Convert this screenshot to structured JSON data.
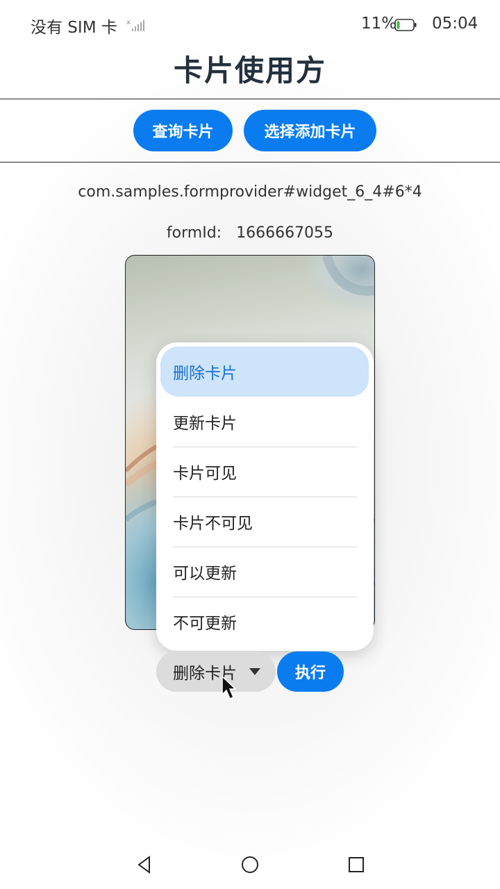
{
  "status_bar": {
    "sim_text": "没有 SIM 卡",
    "battery_text": "11%",
    "time": "05:04"
  },
  "header": {
    "title": "卡片使用方"
  },
  "actions": {
    "query_label": "查询卡片",
    "select_add_label": "选择添加卡片"
  },
  "info": {
    "form_name": "com.samples.formprovider#widget_6_4#6*4",
    "form_id_label": "formId:",
    "form_id_value": "1666667055"
  },
  "menu": {
    "items": [
      {
        "label": "删除卡片",
        "selected": true
      },
      {
        "label": "更新卡片",
        "selected": false
      },
      {
        "label": "卡片可见",
        "selected": false
      },
      {
        "label": "卡片不可见",
        "selected": false
      },
      {
        "label": "可以更新",
        "selected": false
      },
      {
        "label": "不可更新",
        "selected": false
      }
    ]
  },
  "controls": {
    "selected_value": "删除卡片",
    "execute_label": "执行"
  },
  "colors": {
    "accent": "#0a7cf0",
    "selected_bg": "#cde4fa",
    "selected_text": "#1a6fcf"
  },
  "icons": [
    "signal-icon",
    "battery-icon",
    "chevron-down-icon",
    "mouse-cursor-icon",
    "back-icon",
    "home-icon",
    "recents-icon"
  ]
}
